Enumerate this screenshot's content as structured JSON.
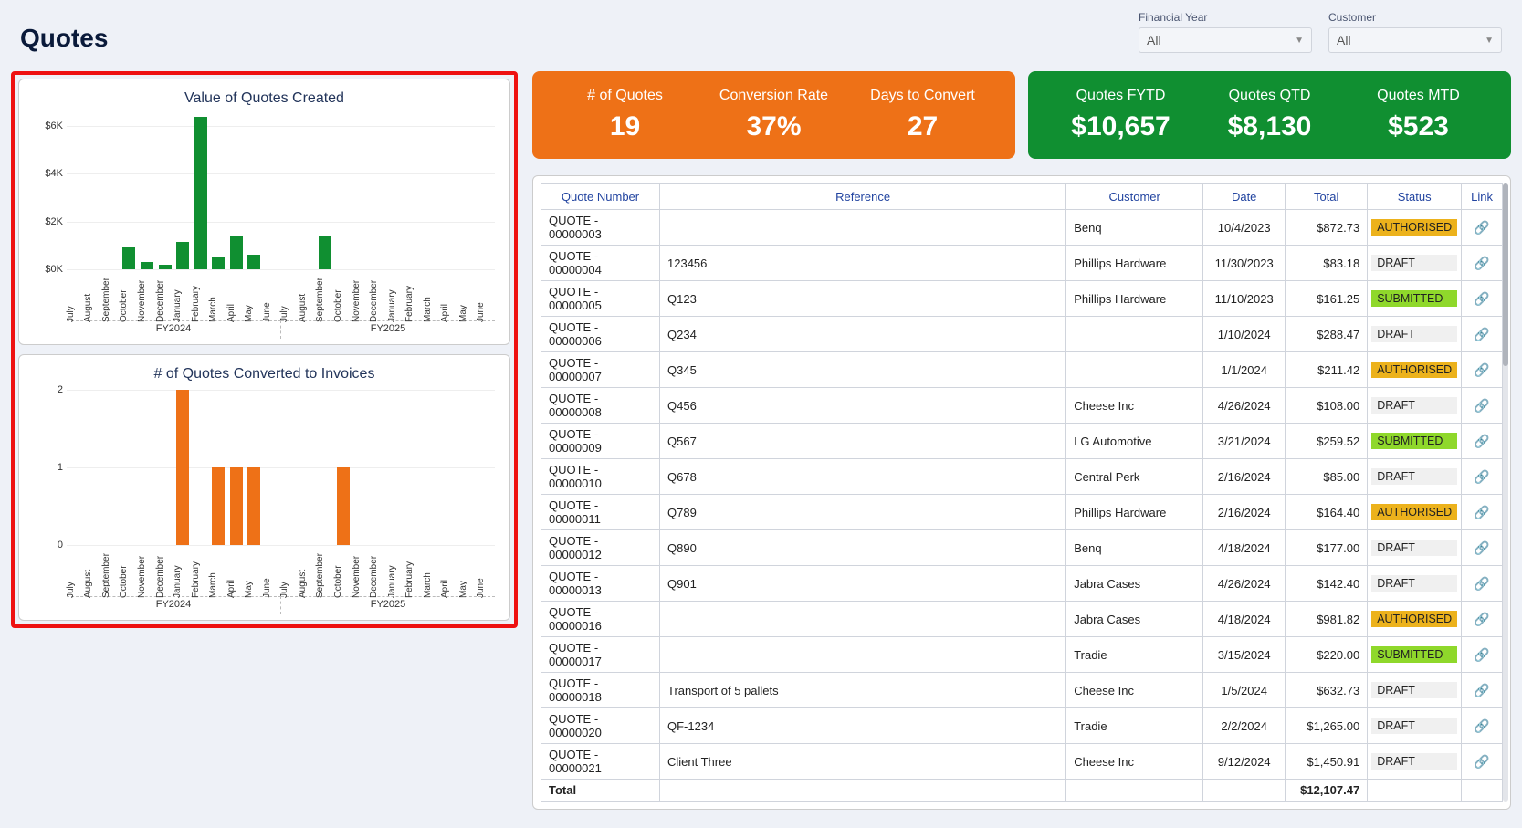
{
  "page_title": "Quotes",
  "filters": {
    "financial_year": {
      "label": "Financial Year",
      "value": "All"
    },
    "customer": {
      "label": "Customer",
      "value": "All"
    }
  },
  "kpis_orange": [
    {
      "label": "# of Quotes",
      "value": "19"
    },
    {
      "label": "Conversion Rate",
      "value": "37%"
    },
    {
      "label": "Days to Convert",
      "value": "27"
    }
  ],
  "kpis_green": [
    {
      "label": "Quotes FYTD",
      "value": "$10,657"
    },
    {
      "label": "Quotes QTD",
      "value": "$8,130"
    },
    {
      "label": "Quotes MTD",
      "value": "$523"
    }
  ],
  "table": {
    "columns": [
      "Quote Number",
      "Reference",
      "Customer",
      "Date",
      "Total",
      "Status",
      "Link"
    ],
    "rows": [
      {
        "num": "QUOTE - 00000003",
        "ref": "",
        "cust": "Benq",
        "date": "10/4/2023",
        "total": "$872.73",
        "status": "AUTHORISED"
      },
      {
        "num": "QUOTE - 00000004",
        "ref": "123456",
        "cust": "Phillips Hardware",
        "date": "11/30/2023",
        "total": "$83.18",
        "status": "DRAFT"
      },
      {
        "num": "QUOTE - 00000005",
        "ref": "Q123",
        "cust": "Phillips Hardware",
        "date": "11/10/2023",
        "total": "$161.25",
        "status": "SUBMITTED"
      },
      {
        "num": "QUOTE - 00000006",
        "ref": "Q234",
        "cust": "",
        "date": "1/10/2024",
        "total": "$288.47",
        "status": "DRAFT"
      },
      {
        "num": "QUOTE - 00000007",
        "ref": "Q345",
        "cust": "",
        "date": "1/1/2024",
        "total": "$211.42",
        "status": "AUTHORISED"
      },
      {
        "num": "QUOTE - 00000008",
        "ref": "Q456",
        "cust": "Cheese Inc",
        "date": "4/26/2024",
        "total": "$108.00",
        "status": "DRAFT"
      },
      {
        "num": "QUOTE - 00000009",
        "ref": "Q567",
        "cust": "LG Automotive",
        "date": "3/21/2024",
        "total": "$259.52",
        "status": "SUBMITTED"
      },
      {
        "num": "QUOTE - 00000010",
        "ref": "Q678",
        "cust": "Central Perk",
        "date": "2/16/2024",
        "total": "$85.00",
        "status": "DRAFT"
      },
      {
        "num": "QUOTE - 00000011",
        "ref": "Q789",
        "cust": "Phillips Hardware",
        "date": "2/16/2024",
        "total": "$164.40",
        "status": "AUTHORISED"
      },
      {
        "num": "QUOTE - 00000012",
        "ref": "Q890",
        "cust": "Benq",
        "date": "4/18/2024",
        "total": "$177.00",
        "status": "DRAFT"
      },
      {
        "num": "QUOTE - 00000013",
        "ref": "Q901",
        "cust": "Jabra Cases",
        "date": "4/26/2024",
        "total": "$142.40",
        "status": "DRAFT"
      },
      {
        "num": "QUOTE - 00000016",
        "ref": "",
        "cust": "Jabra Cases",
        "date": "4/18/2024",
        "total": "$981.82",
        "status": "AUTHORISED"
      },
      {
        "num": "QUOTE - 00000017",
        "ref": "",
        "cust": "Tradie",
        "date": "3/15/2024",
        "total": "$220.00",
        "status": "SUBMITTED"
      },
      {
        "num": "QUOTE - 00000018",
        "ref": "Transport of 5 pallets",
        "cust": "Cheese Inc",
        "date": "1/5/2024",
        "total": "$632.73",
        "status": "DRAFT"
      },
      {
        "num": "QUOTE - 00000020",
        "ref": "QF-1234",
        "cust": "Tradie",
        "date": "2/2/2024",
        "total": "$1,265.00",
        "status": "DRAFT"
      },
      {
        "num": "QUOTE - 00000021",
        "ref": "Client Three",
        "cust": "Cheese Inc",
        "date": "9/12/2024",
        "total": "$1,450.91",
        "status": "DRAFT"
      }
    ],
    "total_label": "Total",
    "total_value": "$12,107.47"
  },
  "chart_data": [
    {
      "type": "bar",
      "title": "Value of Quotes Created",
      "ylabel": "$",
      "ylim": [
        0,
        6500
      ],
      "yticks_labels": [
        "$0K",
        "$2K",
        "$4K",
        "$6K"
      ],
      "yticks_values": [
        0,
        2000,
        4000,
        6000
      ],
      "categories": [
        "July",
        "August",
        "September",
        "October",
        "November",
        "December",
        "January",
        "February",
        "March",
        "April",
        "May",
        "June",
        "July",
        "August",
        "September",
        "October",
        "November",
        "December",
        "January",
        "February",
        "March",
        "April",
        "May",
        "June"
      ],
      "group_labels": [
        "FY2024",
        "FY2025"
      ],
      "values": [
        0,
        0,
        0,
        900,
        300,
        200,
        1150,
        6400,
        500,
        1400,
        600,
        0,
        0,
        0,
        1400,
        0,
        0,
        0,
        0,
        0,
        0,
        0,
        0,
        0
      ],
      "color": "#108f31"
    },
    {
      "type": "bar",
      "title": "# of Quotes Converted to Invoices",
      "ylabel": "",
      "ylim": [
        0,
        2
      ],
      "yticks_labels": [
        "0",
        "1",
        "2"
      ],
      "yticks_values": [
        0,
        1,
        2
      ],
      "categories": [
        "July",
        "August",
        "September",
        "October",
        "November",
        "December",
        "January",
        "February",
        "March",
        "April",
        "May",
        "June",
        "July",
        "August",
        "September",
        "October",
        "November",
        "December",
        "January",
        "February",
        "March",
        "April",
        "May",
        "June"
      ],
      "group_labels": [
        "FY2024",
        "FY2025"
      ],
      "values": [
        0,
        0,
        0,
        0,
        0,
        0,
        2,
        0,
        1,
        1,
        1,
        0,
        0,
        0,
        0,
        1,
        0,
        0,
        0,
        0,
        0,
        0,
        0,
        0
      ],
      "color": "#ee7117"
    }
  ]
}
